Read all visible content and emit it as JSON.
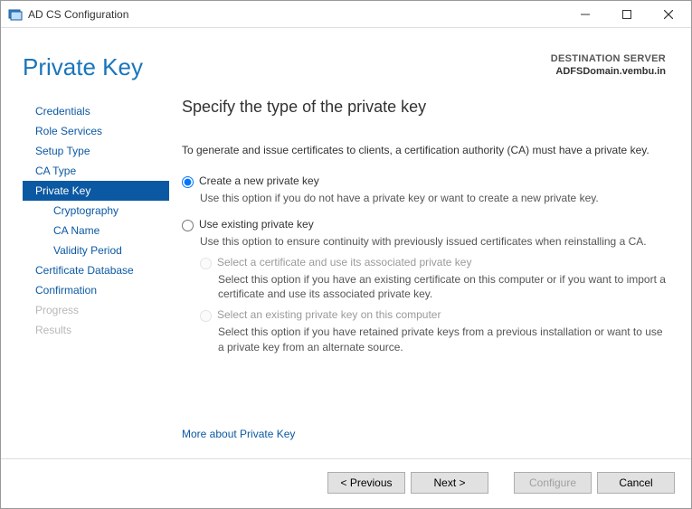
{
  "window": {
    "title": "AD CS Configuration"
  },
  "header": {
    "page_title": "Private Key",
    "dest_label": "DESTINATION SERVER",
    "dest_server": "ADFSDomain.vembu.in"
  },
  "sidebar": {
    "items": [
      {
        "label": "Credentials",
        "sub": false,
        "selected": false,
        "disabled": false
      },
      {
        "label": "Role Services",
        "sub": false,
        "selected": false,
        "disabled": false
      },
      {
        "label": "Setup Type",
        "sub": false,
        "selected": false,
        "disabled": false
      },
      {
        "label": "CA Type",
        "sub": false,
        "selected": false,
        "disabled": false
      },
      {
        "label": "Private Key",
        "sub": false,
        "selected": true,
        "disabled": false
      },
      {
        "label": "Cryptography",
        "sub": true,
        "selected": false,
        "disabled": false
      },
      {
        "label": "CA Name",
        "sub": true,
        "selected": false,
        "disabled": false
      },
      {
        "label": "Validity Period",
        "sub": true,
        "selected": false,
        "disabled": false
      },
      {
        "label": "Certificate Database",
        "sub": false,
        "selected": false,
        "disabled": false
      },
      {
        "label": "Confirmation",
        "sub": false,
        "selected": false,
        "disabled": false
      },
      {
        "label": "Progress",
        "sub": false,
        "selected": false,
        "disabled": true
      },
      {
        "label": "Results",
        "sub": false,
        "selected": false,
        "disabled": true
      }
    ]
  },
  "content": {
    "heading": "Specify the type of the private key",
    "intro": "To generate and issue certificates to clients, a certification authority (CA) must have a private key.",
    "opt1": {
      "label": "Create a new private key",
      "desc": "Use this option if you do not have a private key or want to create a new private key."
    },
    "opt2": {
      "label": "Use existing private key",
      "desc": "Use this option to ensure continuity with previously issued certificates when reinstalling a CA.",
      "sub1": {
        "label": "Select a certificate and use its associated private key",
        "desc": "Select this option if you have an existing certificate on this computer or if you want to import a certificate and use its associated private key."
      },
      "sub2": {
        "label": "Select an existing private key on this computer",
        "desc": "Select this option if you have retained private keys from a previous installation or want to use a private key from an alternate source."
      }
    },
    "more_link": "More about Private Key"
  },
  "footer": {
    "prev": "< Previous",
    "next": "Next >",
    "configure": "Configure",
    "cancel": "Cancel"
  }
}
